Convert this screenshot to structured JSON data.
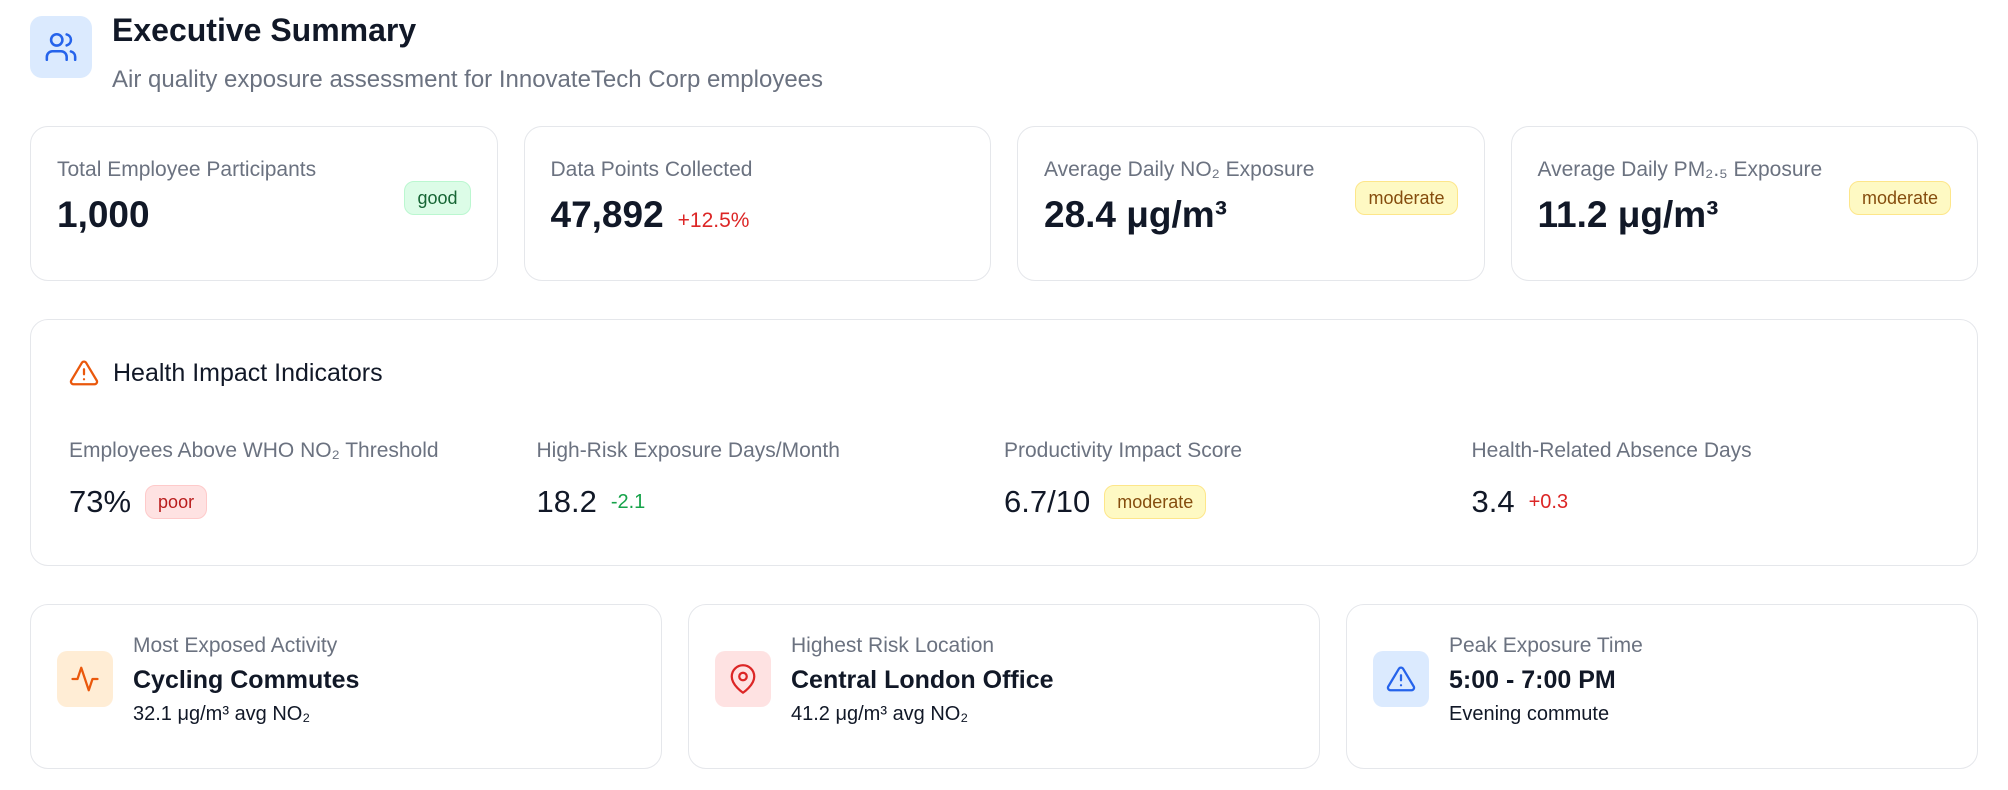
{
  "header": {
    "title": "Executive Summary",
    "subtitle": "Air quality exposure assessment for InnovateTech Corp employees",
    "icon": "users-icon"
  },
  "metrics": [
    {
      "label": "Total Employee Participants",
      "value": "1,000",
      "badge": "good",
      "change": ""
    },
    {
      "label": "Data Points Collected",
      "value": "47,892",
      "badge": "",
      "change": "+12.5%"
    },
    {
      "label": "Average Daily NO₂ Exposure",
      "value": "28.4 μg/m³",
      "badge": "moderate",
      "change": ""
    },
    {
      "label": "Average Daily PM₂.₅ Exposure",
      "value": "11.2 μg/m³",
      "badge": "moderate",
      "change": ""
    }
  ],
  "health": {
    "title": "Health Impact Indicators",
    "icon": "warning-triangle-icon",
    "indicators": [
      {
        "label": "Employees Above WHO NO₂ Threshold",
        "value": "73%",
        "badge": "poor",
        "change": ""
      },
      {
        "label": "High-Risk Exposure Days/Month",
        "value": "18.2",
        "badge": "",
        "change": "-2.1"
      },
      {
        "label": "Productivity Impact Score",
        "value": "6.7/10",
        "badge": "moderate",
        "change": ""
      },
      {
        "label": "Health-Related Absence Days",
        "value": "3.4",
        "badge": "",
        "change": "+0.3"
      }
    ]
  },
  "highlights": [
    {
      "label": "Most Exposed Activity",
      "title": "Cycling Commutes",
      "detail": "32.1 μg/m³ avg NO₂",
      "icon": "activity-icon"
    },
    {
      "label": "Highest Risk Location",
      "title": "Central London Office",
      "detail": "41.2 μg/m³ avg NO₂",
      "icon": "map-pin-icon"
    },
    {
      "label": "Peak Exposure Time",
      "title": "5:00 - 7:00 PM",
      "detail": "Evening commute",
      "icon": "alert-triangle-icon"
    }
  ],
  "colors": {
    "accent_blue": "#2563eb",
    "warning_orange": "#ea580c",
    "danger_red": "#dc2626",
    "positive_green": "#16a34a"
  }
}
